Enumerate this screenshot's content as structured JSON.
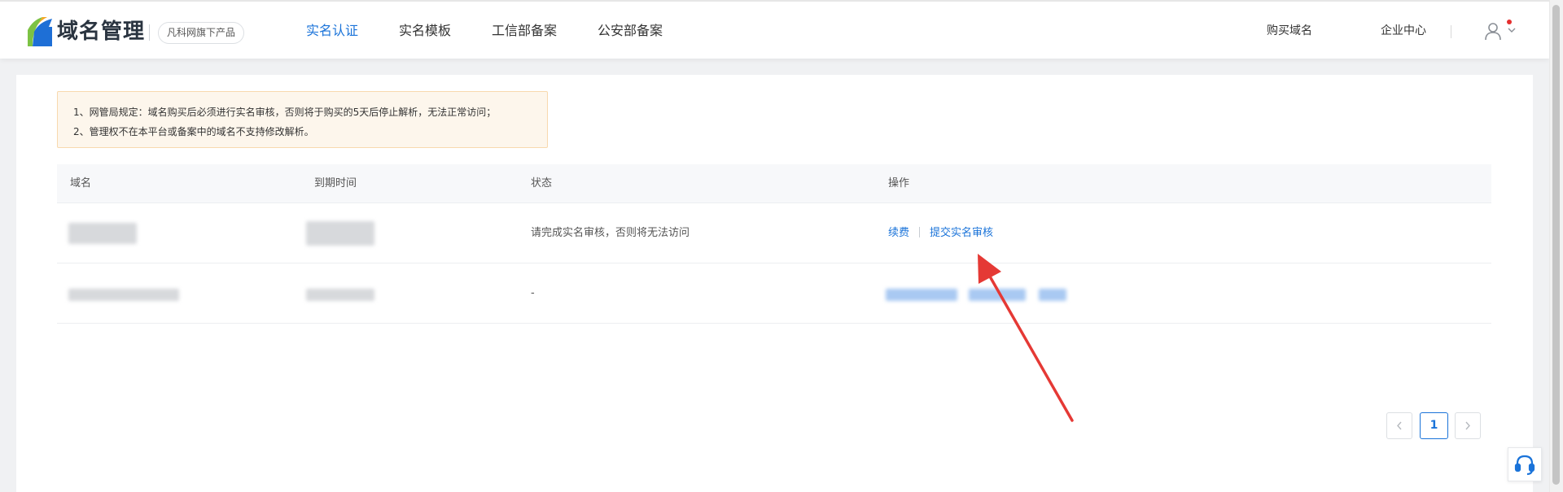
{
  "header": {
    "brand": "域名管理",
    "product_badge": "凡科网旗下产品",
    "nav": [
      {
        "label": "实名认证",
        "active": true
      },
      {
        "label": "实名模板",
        "active": false
      },
      {
        "label": "工信部备案",
        "active": false
      },
      {
        "label": "公安部备案",
        "active": false
      }
    ],
    "buy_domain": "购买域名",
    "enterprise_center": "企业中心"
  },
  "notice": {
    "line1": "1、网管局规定：域名购买后必须进行实名审核，否则将于购买的5天后停止解析，无法正常访问；",
    "line2": "2、管理权不在本平台或备案中的域名不支持修改解析。"
  },
  "table": {
    "columns": [
      "域名",
      "到期时间",
      "状态",
      "操作"
    ],
    "rows": [
      {
        "status": "请完成实名审核，否则将无法访问",
        "actions": [
          "续费",
          "提交实名审核"
        ]
      },
      {
        "status": "-",
        "actions": []
      }
    ]
  },
  "pagination": {
    "current": "1"
  },
  "colors": {
    "accent": "#1a73d9",
    "notice_bg": "#fdf6ec",
    "annotation_arrow": "#e53935"
  }
}
